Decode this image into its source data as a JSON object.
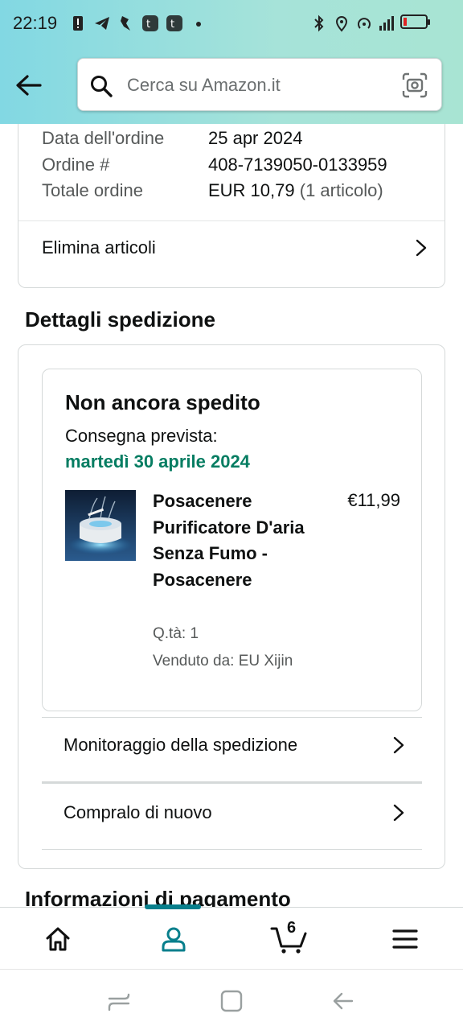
{
  "status_bar": {
    "time": "22:19"
  },
  "search": {
    "placeholder": "Cerca su Amazon.it"
  },
  "order": {
    "date_label": "Data dell'ordine",
    "date_value": "25 apr 2024",
    "number_label": "Ordine #",
    "number_value": "408-7139050-0133959",
    "total_label": "Totale ordine",
    "total_value": "EUR 10,79",
    "total_items": "(1 articolo)",
    "delete_items": "Elimina articoli"
  },
  "shipping": {
    "section_title": "Dettagli spedizione",
    "status": "Non ancora spedito",
    "eta_label": "Consegna prevista:",
    "eta_date": "martedì 30 aprile 2024",
    "product": {
      "name": "Posacenere Purificatore D'aria Senza Fumo - Posacenere",
      "price": "€11,99",
      "qty": "Q.tà: 1",
      "seller": "Venduto da: EU Xijin"
    },
    "track": "Monitoraggio della spedizione",
    "buy_again": "Compralo di nuovo"
  },
  "payment": {
    "section_title": "Informazioni di pagamento"
  },
  "bottom_nav": {
    "items": [
      "home-icon",
      "account-icon",
      "cart-icon",
      "menu-icon"
    ],
    "active": "account",
    "cart_count": "6",
    "accent": "#087f8c"
  },
  "colors": {
    "green": "#067d62",
    "header_gradient_start": "#82d8e3",
    "header_gradient_end": "#a8e4d3"
  }
}
